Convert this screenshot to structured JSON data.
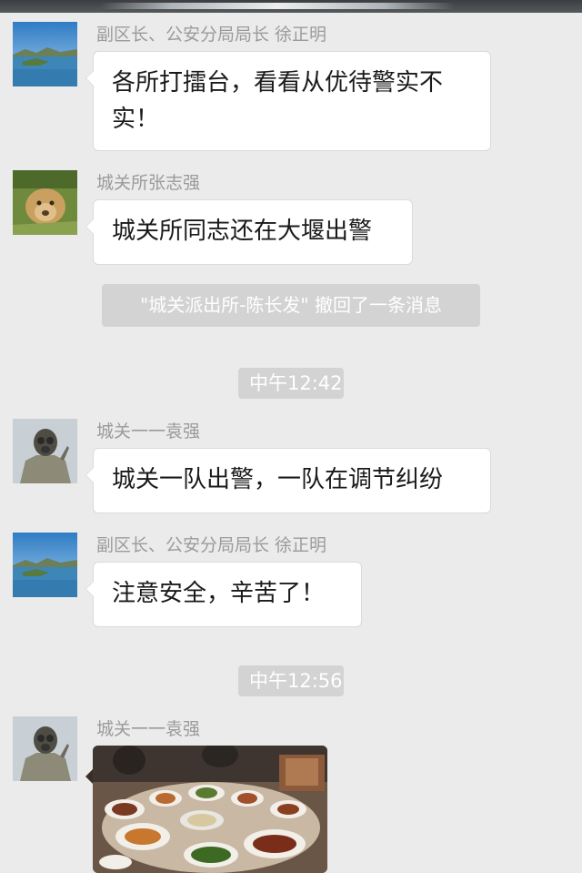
{
  "messages": [
    {
      "sender": "副区长、公安分局局长 徐正明",
      "text": "各所打擂台，看看从优待警实不实！",
      "avatar": "lake-avatar"
    },
    {
      "sender": "城关所张志强",
      "text": "城关所同志还在大堰出警",
      "avatar": "lion-avatar"
    },
    {
      "sender": "城关一一袁强",
      "text": "城关一队出警，一队在调节纠纷",
      "avatar": "gasmask-avatar"
    },
    {
      "sender": "副区长、公安分局局长 徐正明",
      "text": "注意安全，辛苦了！",
      "avatar": "lake-avatar"
    },
    {
      "sender": "城关一一袁强",
      "image": "meal-photo",
      "avatar": "gasmask-avatar"
    }
  ],
  "system": {
    "recall_notice": "\"城关派出所-陈长发\" 撤回了一条消息",
    "time1": "中午12:42",
    "time2": "中午12:56"
  }
}
